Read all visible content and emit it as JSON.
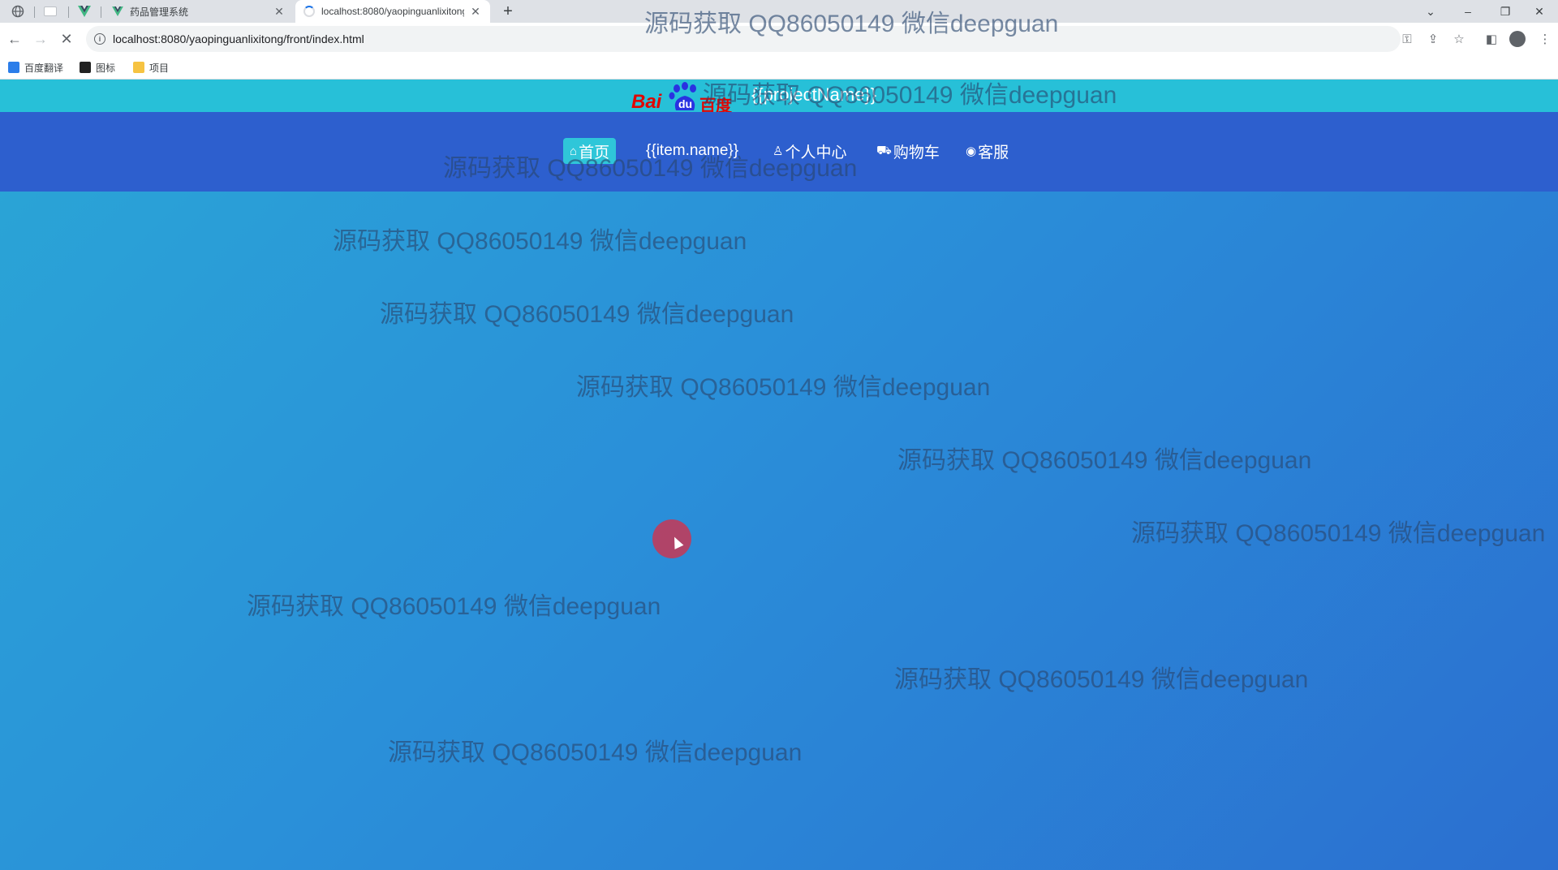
{
  "browser": {
    "tabs": [
      {
        "title": "药品管理系统",
        "icon": "vue-logo-icon"
      },
      {
        "title": "localhost:8080/yaopinguanlixitong",
        "icon": "loading-icon"
      }
    ],
    "address_url": "localhost:8080/yaopinguanlixitong/front/index.html",
    "bookmarks": [
      {
        "label": "百度翻译",
        "color": "#2b7de9"
      },
      {
        "label": "图标",
        "color": "#222222"
      },
      {
        "label": "项目",
        "color": "#f6c342"
      }
    ]
  },
  "page": {
    "logo_text": {
      "bai": "Bai",
      "du": "du",
      "chinese": "百度"
    },
    "project_name": "{{projectName}}",
    "nav": [
      {
        "label": "首页",
        "icon": "home-icon",
        "active": true
      },
      {
        "label": "{{item.name}}",
        "icon": "",
        "active": false
      },
      {
        "label": "个人中心",
        "icon": "person-icon",
        "active": false
      },
      {
        "label": "购物车",
        "icon": "cart-icon",
        "active": false
      },
      {
        "label": "客服",
        "icon": "chat-icon",
        "active": false
      }
    ],
    "watermark": "源码获取 QQ86050149 微信deepguan"
  },
  "colors": {
    "topbar": "#27c0d8",
    "navbar": "#2d5fce",
    "active_nav": "#2fc6d9",
    "cursor_highlight": "#c83755"
  }
}
